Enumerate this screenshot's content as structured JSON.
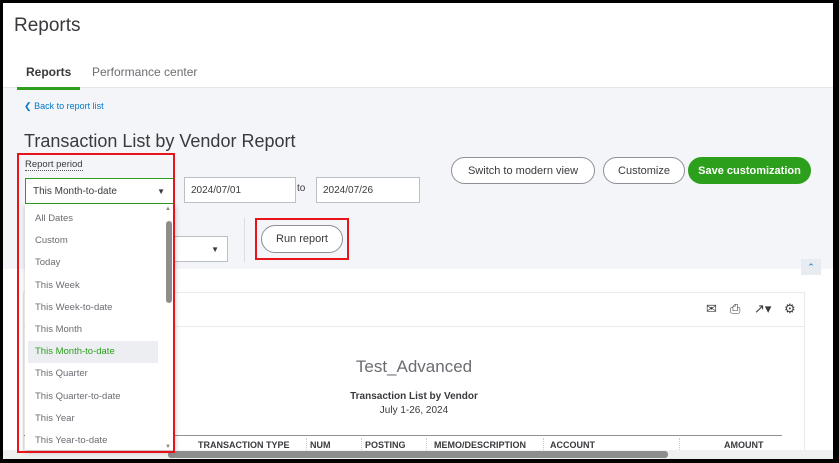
{
  "page": {
    "title": "Reports"
  },
  "tabs": [
    {
      "label": "Reports",
      "active": true
    },
    {
      "label": "Performance center",
      "active": false
    }
  ],
  "back_link": "Back to report list",
  "report": {
    "title": "Transaction List by Vendor Report",
    "company": "Test_Advanced",
    "name": "Transaction List by Vendor",
    "date_range": "July 1-26, 2024"
  },
  "filters": {
    "period_label": "Report period",
    "period_value": "This Month-to-date",
    "from": "2024/07/01",
    "to_label": "to",
    "to": "2024/07/26"
  },
  "buttons": {
    "modern": "Switch to modern view",
    "customize": "Customize",
    "save": "Save customization",
    "run": "Run report"
  },
  "dropdown_options": [
    "All Dates",
    "Custom",
    "Today",
    "This Week",
    "This Week-to-date",
    "This Month",
    "This Month-to-date",
    "This Quarter",
    "This Quarter-to-date",
    "This Year",
    "This Year-to-date"
  ],
  "selected_option": "This Month-to-date",
  "columns": [
    "TRANSACTION TYPE",
    "NUM",
    "POSTING",
    "MEMO/DESCRIPTION",
    "ACCOUNT",
    "AMOUNT"
  ],
  "colors": {
    "accent": "#2ca01c",
    "link": "#0077c5",
    "highlight": "#e8141c"
  }
}
